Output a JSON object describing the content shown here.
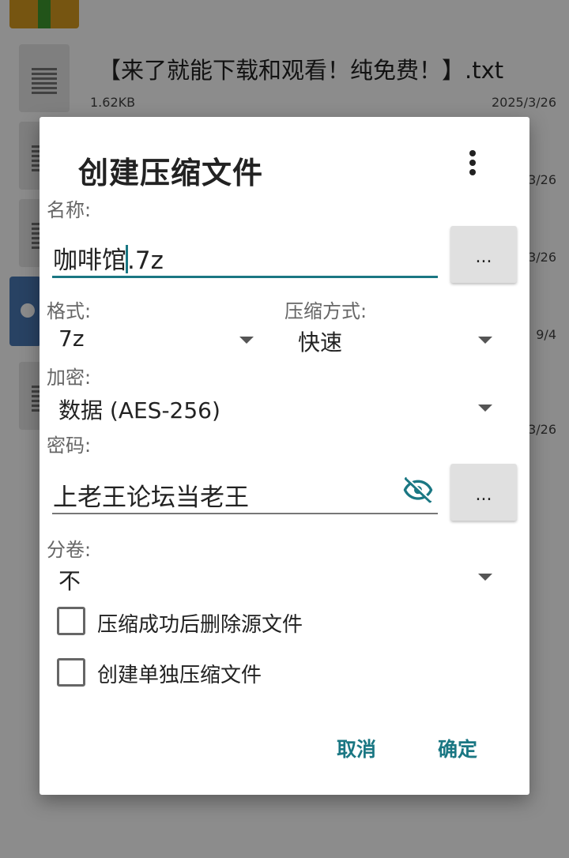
{
  "background": {
    "files": [
      {
        "name": "【来了就能下载和观看！纯免费！】.txt",
        "size": "1.62KB",
        "date": "2025/3/26"
      },
      {
        "date_fragment": "3/26"
      },
      {
        "date_fragment": "3/26"
      },
      {
        "date_fragment": "9/4"
      },
      {
        "date_fragment": "3/26"
      }
    ]
  },
  "dialog": {
    "title": "创建压缩文件",
    "name_label": "名称:",
    "name_value_before_caret": "咖啡馆",
    "name_value_after_caret": ".7z",
    "browse_label": "...",
    "format_label": "格式:",
    "format_value": "7z",
    "compression_label": "压缩方式:",
    "compression_value": "快速",
    "encryption_label": "加密:",
    "encryption_value": "数据 (AES-256)",
    "password_label": "密码:",
    "password_value": "上老王论坛当老王",
    "password_browse_label": "...",
    "split_label": "分卷:",
    "split_value": "不",
    "delete_source_label": "压缩成功后删除源文件",
    "delete_source_checked": false,
    "separate_archives_label": "创建单独压缩文件",
    "separate_archives_checked": false,
    "cancel_label": "取消",
    "ok_label": "确定"
  },
  "colors": {
    "accent": "#1a7783",
    "scrim": "rgba(0,0,0,0.45)"
  },
  "icons": {
    "overflow": "more-vert-icon",
    "visibility": "visibility-off-icon",
    "dropdown": "dropdown-arrow-icon"
  }
}
